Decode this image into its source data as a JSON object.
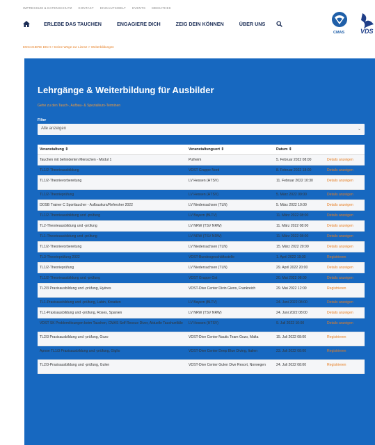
{
  "top_links": [
    "IMPRESSUM & DATENSCHUTZ",
    "KONTAKT",
    "EINKAUFSWELT",
    "EVENTS",
    "MEDIATHEK"
  ],
  "nav": {
    "items": [
      "ERLEBE DAS TAUCHEN",
      "ENGAGIERE DICH",
      "ZEIG DEIN KÖNNEN",
      "ÜBER UNS"
    ],
    "home_icon": "home-icon",
    "search_icon": "search-icon"
  },
  "logos": {
    "cmas": "CMAS",
    "vds": "VDS"
  },
  "breadcrumb": "ENGAGIERE DICH  >  Deine Wege zur Lizenz  >  Weiterbildungen",
  "hero": {
    "title": "Lehrgänge & Weiterbildung für Ausbilder",
    "subtitle": "Gehe zu den Tauch-, Aufbau- & Spezialkurs-Terminen"
  },
  "filter": {
    "label": "Filter",
    "selected": "Alle anzeigen"
  },
  "table": {
    "headers": [
      "Veranstaltung ⇕",
      "Veranstaltungsort ⇕",
      "Datum ⇕"
    ],
    "rows": [
      [
        "Tauchen mit behinderten Menschen - Modul 1",
        "Pulheim",
        "5. Februar 2022 08:00",
        "Details anzeigen"
      ],
      [
        "TL1/2-Theorieausbildung",
        "VDST Gruppe Nord",
        "8. Februar 2022 18:00",
        "Details anzeigen"
      ],
      [
        "TL1/2-Theorievorbereitung",
        "LV Hessen (HTSV)",
        "11. Februar 2022 10:30",
        "Details anzeigen"
      ],
      [
        "TL1/2-Theorieprüfung",
        "LV Hessen (HTSV)",
        "5. März 2022 09:00",
        "Details anzeigen"
      ],
      [
        "DOSB Trainer C Sporttaucher - Aufbaukurs/Refresher 2022",
        "LV Niedersachsen (TLN)",
        "5. März 2022 10:00",
        "Details anzeigen"
      ],
      [
        "TL1/2-Theorieausbildung und -prüfung",
        "LV Bayern (BLTV)",
        "11. März 2022 08:00",
        "Details anzeigen"
      ],
      [
        "TL2-Theorieausbildung und -prüfung",
        "LV NRW (TSV NRW)",
        "11. März 2022 08:00",
        "Details anzeigen"
      ],
      [
        "TL1-Theorieausbildung und -prüfung",
        "LV NRW (TSV NRW)",
        "11. März 2022 08:00",
        "Details anzeigen"
      ],
      [
        "TL1/2-Theorievorbereitung",
        "LV Niedersachsen (TLN)",
        "15. März 2022 20:00",
        "Details anzeigen"
      ],
      [
        "TL3-Theorieprüfung 2022",
        "VDST-Bundesgeschäftsstelle",
        "1. April 2022 19:30",
        "Registrieren"
      ],
      [
        "TL1/2-Theorieprüfung",
        "LV Niedersachsen (TLN)",
        "29. April 2022 20:00",
        "Details anzeigen"
      ],
      [
        "TL1/2-Theorieausbildung und -prüfung",
        "VDST Gruppe Ost",
        "20. Mai 2022 08:00",
        "Details anzeigen"
      ],
      [
        "TL2/3 Praxisausbildung und -prüfung, Hyères",
        "VDST-Dive Center Divin Giens, Frankreich",
        "29. Mai 2022 12:00",
        "Registrieren"
      ],
      [
        "TL1-Praxisausbildung und -prüfung, Labin, Kroatien",
        "LV Bayern (BLTV)",
        "24. Juni 2022 08:00",
        "Details anzeigen"
      ],
      [
        "TL1-Praxisausbildung und -prüfung, Roses, Spanien",
        "LV NRW (TSV NRW)",
        "24. Juni 2022 08:00",
        "Details anzeigen"
      ],
      [
        "VDST SK Problemlösungen beim Tauchen, CMAS Self Rescue Diver, Aktuelle Tauchunfälle",
        "LV Hessen (HTSV)",
        "9. Juli 2022 10:00",
        "Details anzeigen"
      ],
      [
        "TL2/3 Praxisausbildung und -prüfung, Gozo",
        "VDST-Dive Center Nautic Team Gozo, Malta",
        "15. Juli 2022 08:00",
        "Registrieren"
      ],
      [
        "Apnoe TL1/3 Praxisausbildung und -prüfung, Giglio",
        "VDST-Dive Center Deep Blue Diving, Italien",
        "23. Juli 2022 08:00",
        "Registrieren"
      ],
      [
        "TL2/3-Praxisausbildung und -prüfung, Gulen",
        "VDST-Dive Center Gulen Dive Resort, Norwegen",
        "24. Juli 2022 08:00",
        "Registrieren"
      ]
    ]
  },
  "colors": {
    "hero_bg": "#1768c0",
    "accent": "#e67e22",
    "nav_text": "#1a2c55"
  }
}
